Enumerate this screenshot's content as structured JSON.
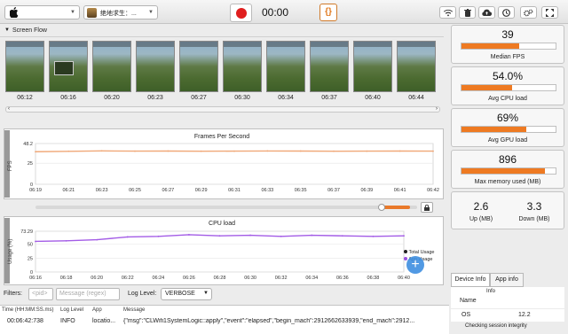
{
  "toolbar": {
    "device_select_value": "",
    "game_select_value": "绝地求生：...",
    "timer": "00:00",
    "code_button_label": "{}",
    "icons": [
      "wifi-icon",
      "trash-icon",
      "cloud-upload-icon",
      "clock-icon",
      "settings-icon",
      "expand-icon"
    ]
  },
  "screen_flow": {
    "title": "Screen Flow",
    "timestamps": [
      "06:12",
      "06:16",
      "06:20",
      "06:23",
      "06:27",
      "06:30",
      "06:34",
      "06:37",
      "06:40",
      "06:44"
    ]
  },
  "fps_chart": {
    "title": "Frames Per Second",
    "ylabel": "FPS"
  },
  "cpu_chart": {
    "title": "CPU load",
    "ylabel": "Usage (%)",
    "legend_total": "Total Usage",
    "legend_app": "App Usage"
  },
  "filters": {
    "label": "Filters:",
    "pid_placeholder": "<pid>",
    "message_placeholder": "Message (regex)",
    "log_level_label": "Log Level:",
    "log_level_value": "VERBOSE"
  },
  "log_table": {
    "headers": [
      "Time (HH:MM:SS.ms)",
      "Log Level",
      "App",
      "Message"
    ],
    "row": {
      "time": "00:06:42:738",
      "level": "INFO",
      "app": "locatio...",
      "message": "{\"msg\":\"CLWifi1SystemLogic::apply\",\"event\":\"elapsed\",\"begin_mach\":2912662633939,\"end_mach\":2912..."
    }
  },
  "stats": {
    "fps": {
      "value": "39",
      "label": "Median FPS",
      "fill": 0.61
    },
    "cpu": {
      "value": "54.0%",
      "label": "Avg CPU load",
      "fill": 0.54
    },
    "gpu": {
      "value": "69%",
      "label": "Avg GPU load",
      "fill": 0.69
    },
    "memory": {
      "value": "896",
      "label": "Max memory used (MB)",
      "fill": 0.89
    },
    "up": {
      "value": "2.6",
      "label": "Up (MB)"
    },
    "down": {
      "value": "3.3",
      "label": "Down (MB)"
    }
  },
  "device_info": {
    "tab_device": "Device Info",
    "tab_app": "App info",
    "rows": [
      {
        "key": "Name",
        "value": "Info"
      },
      {
        "key": "OS",
        "value": "12.2"
      }
    ],
    "status": "Checking session integrity"
  },
  "watermark": "",
  "chart_data": [
    {
      "type": "line",
      "title": "Frames Per Second",
      "xlabel": "",
      "ylabel": "FPS",
      "x": [
        "06:19",
        "06:21",
        "06:23",
        "06:25",
        "06:27",
        "06:29",
        "06:31",
        "06:33",
        "06:35",
        "06:37",
        "06:39",
        "06:41",
        "06:42"
      ],
      "ylim": [
        0,
        48.2
      ],
      "yticks": [
        0,
        25,
        48.2
      ],
      "series": [
        {
          "values": [
            38.5,
            39,
            39.5,
            39.2,
            39.3,
            39.1,
            39.2,
            39.4,
            39.3,
            39.1,
            39.2,
            39.3,
            39.2
          ]
        }
      ]
    },
    {
      "type": "line",
      "title": "CPU load",
      "xlabel": "",
      "ylabel": "Usage (%)",
      "x": [
        "06:16",
        "06:18",
        "06:20",
        "06:22",
        "06:24",
        "06:26",
        "06:28",
        "06:30",
        "06:32",
        "06:34",
        "06:36",
        "06:38",
        "06:40"
      ],
      "ylim": [
        0,
        73.29
      ],
      "yticks": [
        0,
        25,
        50,
        73.29
      ],
      "series": [
        {
          "name": "Total Usage",
          "values": [
            55,
            56,
            58,
            63,
            64,
            67,
            65,
            66,
            64,
            66,
            65,
            64,
            65
          ]
        }
      ]
    }
  ]
}
